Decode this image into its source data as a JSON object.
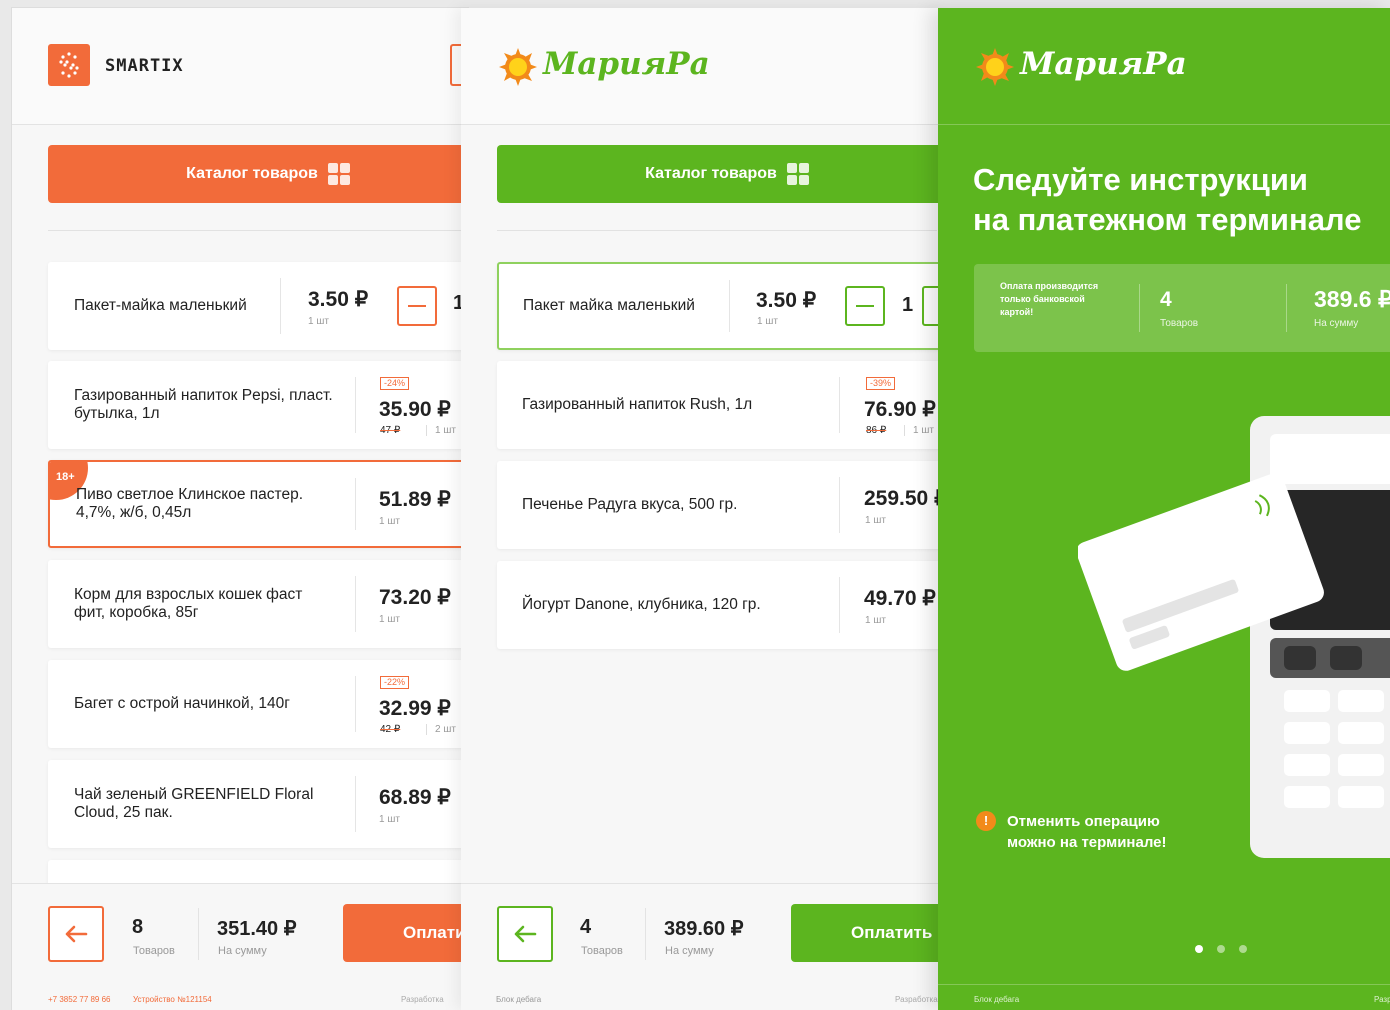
{
  "colors": {
    "smartix_accent": "#f26b3a",
    "mariara_accent": "#5cb51f"
  },
  "p1": {
    "brand": "SMARTIX",
    "catalog_label": "Каталог товаров",
    "items": [
      {
        "name": "Пакет-майка маленький",
        "price": "3.50 ₽",
        "unit": "1 шт",
        "qty": "1"
      },
      {
        "name": "Газированный напиток Pepsi, пласт. бутылка, 1л",
        "price": "35.90 ₽",
        "unit": "1 шт",
        "old": "47 ₽",
        "discount": "-24%"
      },
      {
        "name": "Пиво светлое Клинское пастер. 4,7%, ж/б, 0,45л",
        "price": "51.89 ₽",
        "unit": "1 шт",
        "age": "18+"
      },
      {
        "name": "Корм для взрослых кошек фаст фит, коробка, 85г",
        "price": "73.20 ₽",
        "unit": "1 шт"
      },
      {
        "name": "Багет с острой начинкой, 140г",
        "price": "32.99 ₽",
        "unit": "2 шт",
        "old": "42 ₽",
        "discount": "-22%"
      },
      {
        "name": "Чай зеленый GREENFIELD Floral Cloud, 25 пак.",
        "price": "68.89 ₽",
        "unit": "1 шт"
      }
    ],
    "footer": {
      "count": "8",
      "count_label": "Товаров",
      "sum": "351.40 ₽",
      "sum_label": "На сумму",
      "pay": "Оплатить"
    },
    "phone": "+7 3852 77 89 66",
    "device": "Устройство №121154",
    "dev": "Разработка"
  },
  "p2": {
    "brand": "МарияРа",
    "catalog_label": "Каталог товаров",
    "items": [
      {
        "name": "Пакет майка маленький",
        "price": "3.50 ₽",
        "unit": "1 шт",
        "qty": "1"
      },
      {
        "name": "Газированный напиток Rush, 1л",
        "price": "76.90 ₽",
        "unit": "1 шт",
        "old": "86 ₽",
        "discount": "-39%"
      },
      {
        "name": "Печенье Радуга вкуса, 500 гр.",
        "price": "259.50 ₽",
        "unit": "1 шт"
      },
      {
        "name": "Йогурт Danone, клубника, 120 гр.",
        "price": "49.70 ₽",
        "unit": "1 шт"
      }
    ],
    "footer": {
      "count": "4",
      "count_label": "Товаров",
      "sum": "389.60 ₽",
      "sum_label": "На сумму",
      "pay": "Оплатить"
    },
    "block": "Блок дебага",
    "dev": "Разработка"
  },
  "p3": {
    "brand": "МарияРа",
    "title_line1": "Следуйте инструкции",
    "title_line2": "на платежном терминале",
    "info_note": "Оплата производится только банковской картой!",
    "count": "4",
    "count_label": "Товаров",
    "sum": "389.6 ₽",
    "sum_label": "На сумму",
    "cancel_line1": "Отменить операцию",
    "cancel_line2": "можно на терминале!",
    "block": "Блок дебага",
    "dev": "Разр"
  }
}
